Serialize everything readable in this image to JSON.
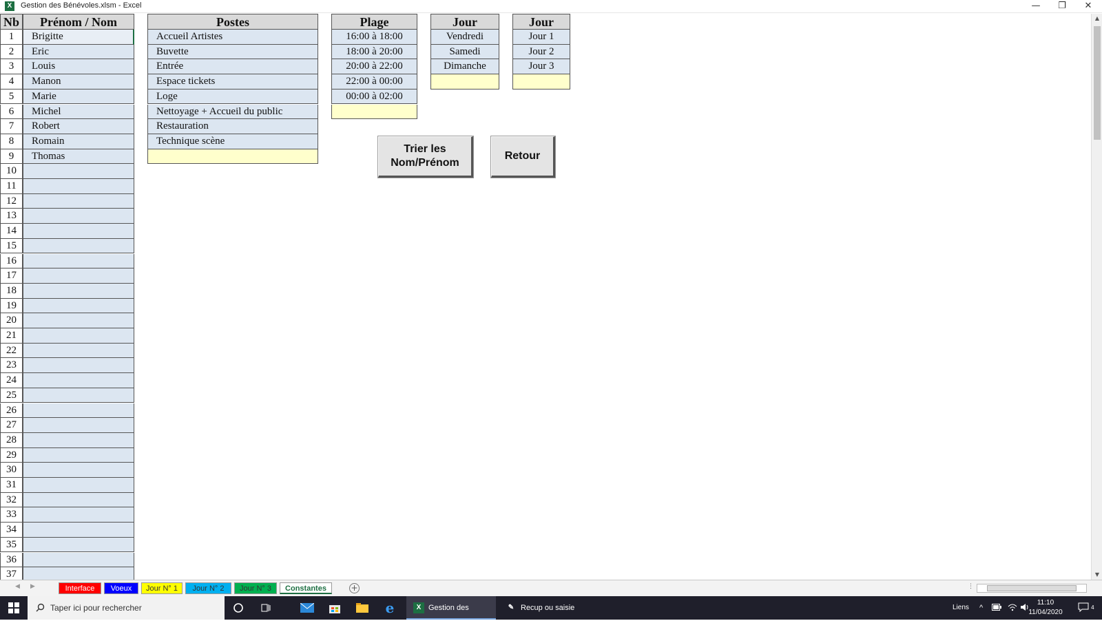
{
  "window": {
    "title": "Gestion des Bénévoles.xlsm - Excel",
    "app_icon": "X",
    "controls": [
      "—",
      "❐",
      "✕"
    ]
  },
  "tables": {
    "names": {
      "header_nb": "Nb",
      "header": "Prénom / Nom",
      "rows": [
        {
          "nb": "1",
          "name": "Brigitte"
        },
        {
          "nb": "2",
          "name": "Eric"
        },
        {
          "nb": "3",
          "name": "Louis"
        },
        {
          "nb": "4",
          "name": "Manon"
        },
        {
          "nb": "5",
          "name": "Marie"
        },
        {
          "nb": "6",
          "name": "Michel"
        },
        {
          "nb": "7",
          "name": "Robert"
        },
        {
          "nb": "8",
          "name": "Romain"
        },
        {
          "nb": "9",
          "name": "Thomas"
        },
        {
          "nb": "10",
          "name": ""
        },
        {
          "nb": "11",
          "name": ""
        },
        {
          "nb": "12",
          "name": ""
        },
        {
          "nb": "13",
          "name": ""
        },
        {
          "nb": "14",
          "name": ""
        },
        {
          "nb": "15",
          "name": ""
        },
        {
          "nb": "16",
          "name": ""
        },
        {
          "nb": "17",
          "name": ""
        },
        {
          "nb": "18",
          "name": ""
        },
        {
          "nb": "19",
          "name": ""
        },
        {
          "nb": "20",
          "name": ""
        },
        {
          "nb": "21",
          "name": ""
        },
        {
          "nb": "22",
          "name": ""
        },
        {
          "nb": "23",
          "name": ""
        },
        {
          "nb": "24",
          "name": ""
        },
        {
          "nb": "25",
          "name": ""
        },
        {
          "nb": "26",
          "name": ""
        },
        {
          "nb": "27",
          "name": ""
        },
        {
          "nb": "28",
          "name": ""
        },
        {
          "nb": "29",
          "name": ""
        },
        {
          "nb": "30",
          "name": ""
        },
        {
          "nb": "31",
          "name": ""
        },
        {
          "nb": "32",
          "name": ""
        },
        {
          "nb": "33",
          "name": ""
        },
        {
          "nb": "34",
          "name": ""
        },
        {
          "nb": "35",
          "name": ""
        },
        {
          "nb": "36",
          "name": ""
        },
        {
          "nb": "37",
          "name": ""
        }
      ]
    },
    "postes": {
      "header": "Postes",
      "rows": [
        "Accueil Artistes",
        "Buvette",
        "Entrée",
        "Espace tickets",
        "Loge",
        "Nettoyage + Accueil du public",
        "Restauration",
        "Technique scène",
        ""
      ]
    },
    "plage": {
      "header": "Plage",
      "rows": [
        "16:00 à 18:00",
        "18:00 à 20:00",
        "20:00 à 22:00",
        "22:00 à 00:00",
        "00:00 à 02:00",
        ""
      ]
    },
    "jour_nom": {
      "header": "Jour",
      "rows": [
        "Vendredi",
        "Samedi",
        "Dimanche",
        ""
      ]
    },
    "jour_num": {
      "header": "Jour",
      "rows": [
        "Jour 1",
        "Jour 2",
        "Jour 3",
        ""
      ]
    }
  },
  "buttons": {
    "sort": "Trier les Nom/Prénom",
    "sort_line1": "Trier les",
    "sort_line2": "Nom/Prénom",
    "back": "Retour"
  },
  "sheet_tabs": [
    {
      "label": "Interface",
      "bg": "#ff0000",
      "fg": "#ffffff"
    },
    {
      "label": "Voeux",
      "bg": "#0000ff",
      "fg": "#ffffff"
    },
    {
      "label": "Jour N° 1",
      "bg": "#ffff00",
      "fg": "#333333"
    },
    {
      "label": "Jour N° 2",
      "bg": "#00b0f0",
      "fg": "#333333"
    },
    {
      "label": "Jour N° 3",
      "bg": "#00b050",
      "fg": "#333333"
    },
    {
      "label": "Constantes",
      "bg": "#ffffff",
      "fg": "#1d6f42",
      "active": true
    }
  ],
  "taskbar": {
    "search_placeholder": "Taper ici pour rechercher",
    "tasks": [
      {
        "label": "Gestion des Bénévo...",
        "icon": "X",
        "active": true
      },
      {
        "label": "Recup ou saisie dir...",
        "icon": "✎",
        "active": false
      }
    ],
    "tray_links": "Liens",
    "time": "11:10",
    "date": "11/04/2020",
    "notification_count": "4"
  },
  "colors": {
    "header_gray": "#d9d9d9",
    "cell_blue": "#dce6f1",
    "cell_yellow": "#ffffcc",
    "excel_green": "#1d6f42"
  }
}
